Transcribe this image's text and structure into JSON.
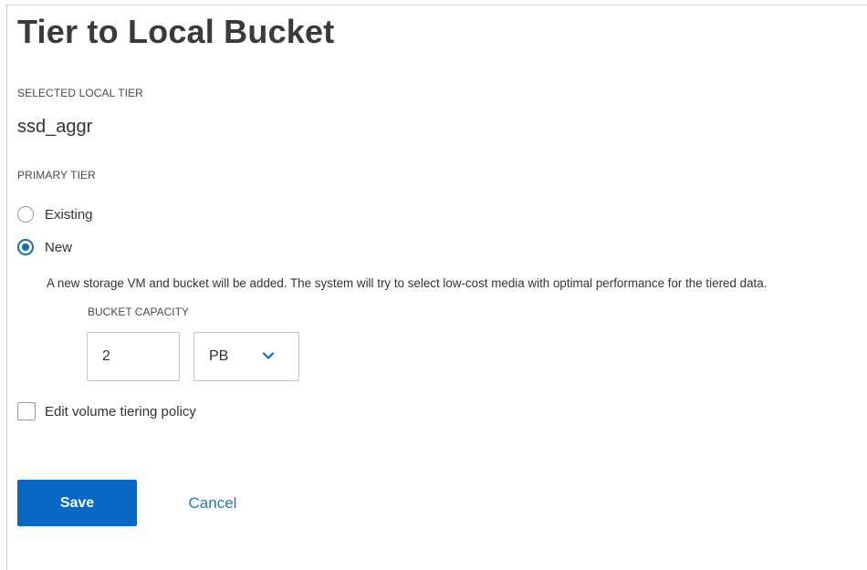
{
  "title": "Tier to Local Bucket",
  "selected_local_tier": {
    "label": "SELECTED LOCAL TIER",
    "value": "ssd_aggr"
  },
  "primary_tier": {
    "label": "PRIMARY TIER",
    "options": [
      {
        "label": "Existing",
        "selected": false
      },
      {
        "label": "New",
        "selected": true
      }
    ],
    "help_text": "A new storage VM and bucket will be added. The system will try to select low-cost media with optimal performance for the tiered data."
  },
  "bucket_capacity": {
    "label": "BUCKET CAPACITY",
    "value": "2",
    "unit": "PB"
  },
  "edit_policy": {
    "label": "Edit volume tiering policy",
    "checked": false
  },
  "actions": {
    "save_label": "Save",
    "cancel_label": "Cancel"
  },
  "colors": {
    "primary": "#0b67c4",
    "link": "#2a72c0",
    "radio_selected": "#0d6cc9"
  },
  "icons": {
    "unit_dropdown": "chevron-down-icon"
  }
}
